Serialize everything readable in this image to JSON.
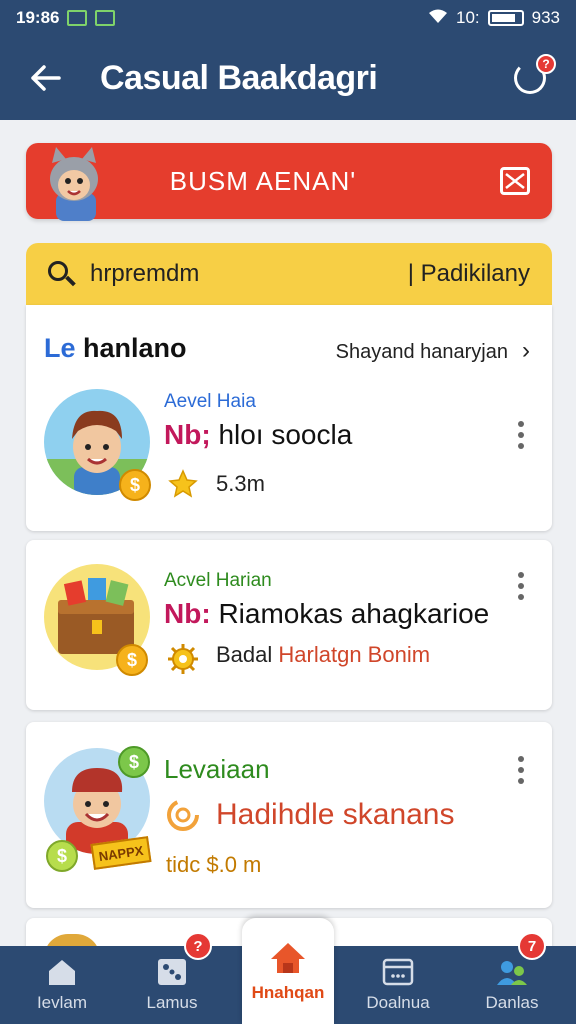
{
  "status": {
    "time": "19:86",
    "signal": "10:",
    "battery": "933",
    "battery_level": 0.85
  },
  "appbar": {
    "title": "Casual Baakdagri",
    "badge": "?"
  },
  "banner": {
    "text": "BUSM AENAN'"
  },
  "search": {
    "value": "hrpremdm",
    "filter": "Padikilany"
  },
  "section": {
    "title_prefix": "Le",
    "title": "hanlano",
    "link": "Shayand hanaryjan"
  },
  "cards": [
    {
      "tag": "Aevel Haia",
      "no": "Nb;",
      "name": "hloı soocla",
      "meta": "5.3m",
      "tag_color": "#2c6bd6"
    },
    {
      "tag": "Acvel Harian",
      "no": "Nb:",
      "name": "Riamokas ahagkarioe",
      "meta_a": "Badal",
      "meta_b": "Harlatgn Bonim",
      "tag_color": "#2e8b1e"
    },
    {
      "tag": "Levaiaan",
      "name": "Hadihdle skanans",
      "meta": "tidc $.0 m",
      "tag_color": "#2e8b1e",
      "ribbon": "NAPPX"
    }
  ],
  "nav": [
    {
      "label": "Ievlam",
      "badge": ""
    },
    {
      "label": "Lamus",
      "badge": "?"
    },
    {
      "label": "Hnahqan",
      "badge": ""
    },
    {
      "label": "Doalnua",
      "badge": ""
    },
    {
      "label": "Danlas",
      "badge": "7"
    }
  ],
  "colors": {
    "primary": "#2c4a72",
    "banner": "#e53d2d",
    "search": "#f7cf45",
    "accent": "#e04a16"
  }
}
